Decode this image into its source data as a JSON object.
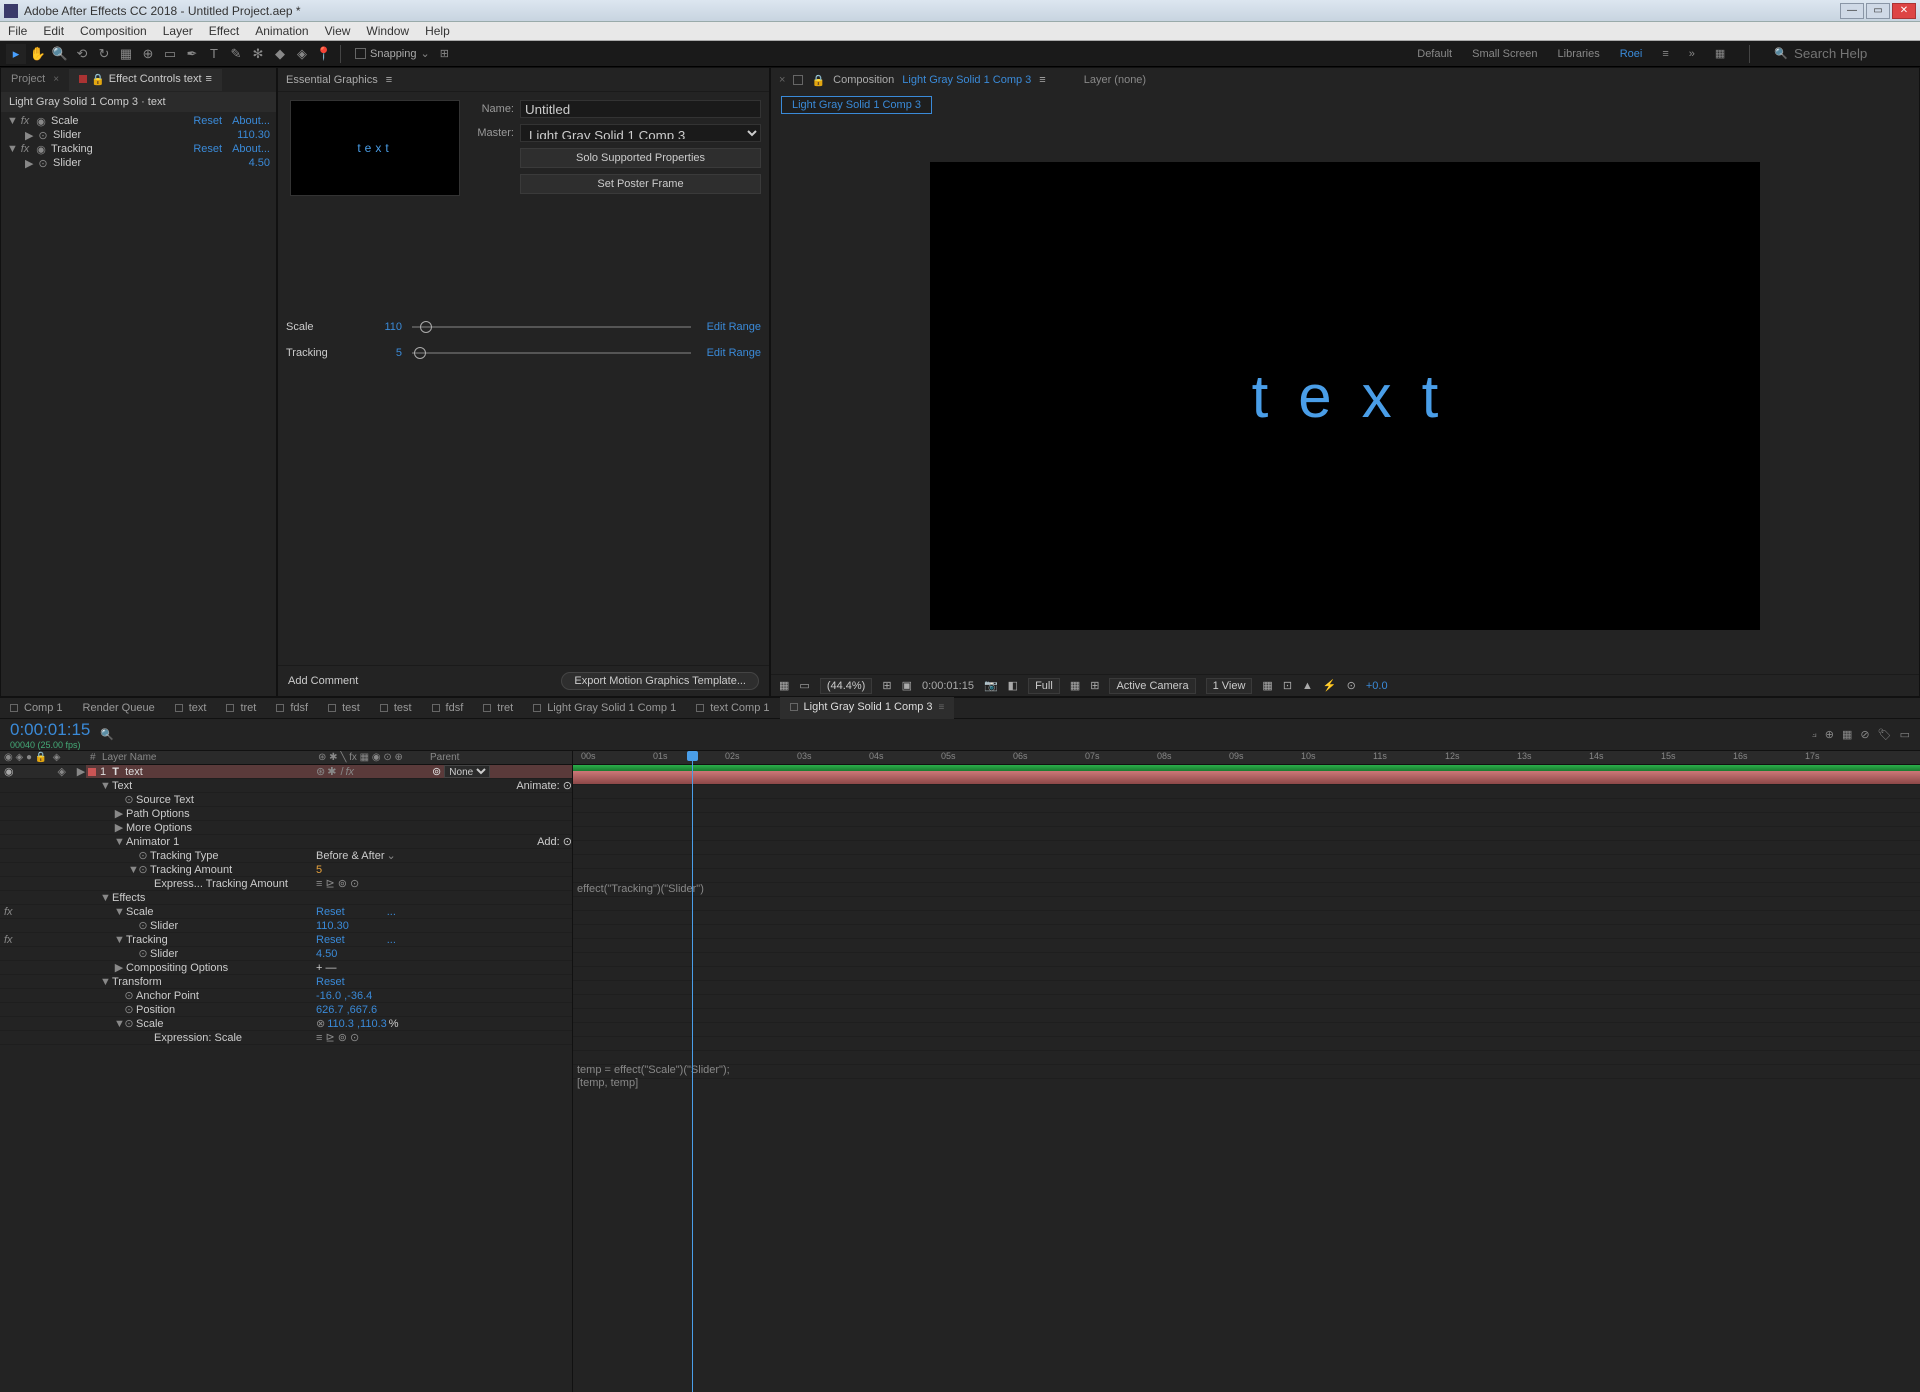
{
  "title": "Adobe After Effects CC 2018 - Untitled Project.aep *",
  "menu": [
    "File",
    "Edit",
    "Composition",
    "Layer",
    "Effect",
    "Animation",
    "View",
    "Window",
    "Help"
  ],
  "toolbar": {
    "snapping": "Snapping",
    "workspaces": [
      "Default",
      "Small Screen",
      "Libraries"
    ],
    "active_workspace": "Roei",
    "search_placeholder": "Search Help"
  },
  "project_panel": {
    "tabs": [
      {
        "label": "Project"
      },
      {
        "label": "Effect Controls text",
        "active": true
      }
    ],
    "header": "Light Gray Solid 1 Comp 3 · text",
    "effects": [
      {
        "name": "Scale",
        "reset": "Reset",
        "about": "About...",
        "slider_label": "Slider",
        "slider_value": "110.30"
      },
      {
        "name": "Tracking",
        "reset": "Reset",
        "about": "About...",
        "slider_label": "Slider",
        "slider_value": "4.50"
      }
    ]
  },
  "eg_panel": {
    "title": "Essential Graphics",
    "preview_text": "text",
    "name_label": "Name:",
    "name_value": "Untitled",
    "master_label": "Master:",
    "master_value": "Light Gray Solid 1 Comp 3",
    "solo_btn": "Solo Supported Properties",
    "poster_btn": "Set Poster Frame",
    "sliders": [
      {
        "label": "Scale",
        "value": "110",
        "pos": 8,
        "edit": "Edit Range"
      },
      {
        "label": "Tracking",
        "value": "5",
        "pos": 2,
        "edit": "Edit Range"
      }
    ],
    "add_comment": "Add Comment",
    "export": "Export Motion Graphics Template..."
  },
  "comp_panel": {
    "prefix": "Composition",
    "name": "Light Gray Solid 1 Comp 3",
    "layer_label": "Layer  (none)",
    "breadcrumb": "Light Gray Solid 1 Comp 3",
    "canvas_text": "text",
    "controls": {
      "zoom": "(44.4%)",
      "time": "0:00:01:15",
      "res": "Full",
      "camera": "Active Camera",
      "views": "1 View",
      "exposure": "+0.0"
    }
  },
  "timeline": {
    "tabs": [
      {
        "label": "Comp 1"
      },
      {
        "label": "Render Queue",
        "nosq": true
      },
      {
        "label": "text"
      },
      {
        "label": "tret"
      },
      {
        "label": "fdsf"
      },
      {
        "label": "test"
      },
      {
        "label": "test"
      },
      {
        "label": "fdsf"
      },
      {
        "label": "tret"
      },
      {
        "label": "Light Gray Solid 1 Comp 1"
      },
      {
        "label": "text Comp 1"
      },
      {
        "label": "Light Gray Solid 1 Comp 3",
        "active": true,
        "close": true
      }
    ],
    "current_time": "0:00:01:15",
    "sub_time": "00040 (25.00 fps)",
    "col_headers": {
      "num": "#",
      "layer": "Layer Name",
      "parent": "Parent"
    },
    "ticks": [
      "00s",
      "01s",
      "02s",
      "03s",
      "04s",
      "05s",
      "06s",
      "07s",
      "08s",
      "09s",
      "10s",
      "11s",
      "12s",
      "13s",
      "14s",
      "15s",
      "16s",
      "17s"
    ],
    "layer": {
      "num": "1",
      "icon": "T",
      "name": "text",
      "mode": "None",
      "rows": [
        {
          "indent": 1,
          "tw": "▼",
          "name": "Text",
          "right": "Animate: ⊙"
        },
        {
          "indent": 2,
          "stop": "⊙",
          "name": "Source Text"
        },
        {
          "indent": 2,
          "tw": "▶",
          "name": "Path Options"
        },
        {
          "indent": 2,
          "tw": "▶",
          "name": "More Options"
        },
        {
          "indent": 2,
          "tw": "▼",
          "name": "Animator 1",
          "right": "Add: ⊙"
        },
        {
          "indent": 3,
          "stop": "⊙",
          "name": "Tracking Type",
          "val": "Before & After",
          "dd": true
        },
        {
          "indent": 3,
          "tw": "▼",
          "stop": "⊙",
          "name": "Tracking Amount",
          "val": "5",
          "orange": true
        },
        {
          "indent": 4,
          "name": "Express... Tracking Amount",
          "expr": true
        },
        {
          "indent": 1,
          "tw": "▼",
          "name": "Effects"
        },
        {
          "indent": 2,
          "tw": "▼",
          "name": "Scale",
          "link": "Reset",
          "dots": true,
          "fx": true
        },
        {
          "indent": 3,
          "stop": "⊙",
          "name": "Slider",
          "link": "110.30"
        },
        {
          "indent": 2,
          "tw": "▼",
          "name": "Tracking",
          "link": "Reset",
          "dots": true,
          "fx": true
        },
        {
          "indent": 3,
          "stop": "⊙",
          "name": "Slider",
          "link": "4.50"
        },
        {
          "indent": 2,
          "tw": "▶",
          "name": "Compositing Options",
          "plus": true
        },
        {
          "indent": 1,
          "tw": "▼",
          "name": "Transform",
          "link": "Reset"
        },
        {
          "indent": 2,
          "stop": "⊙",
          "name": "Anchor Point",
          "link": "-16.0 ,-36.4"
        },
        {
          "indent": 2,
          "stop": "⊙",
          "name": "Position",
          "link": "626.7 ,667.6"
        },
        {
          "indent": 2,
          "tw": "▼",
          "stop": "⊙",
          "name": "Scale",
          "linkpair": "110.3 ,110.3",
          "pct": "%",
          "chain": true
        },
        {
          "indent": 4,
          "name": "Expression: Scale",
          "expr": true
        }
      ]
    },
    "expr1": "effect(\"Tracking\")(\"Slider\")",
    "expr2a": "temp = effect(\"Scale\")(\"Slider\");",
    "expr2b": "[temp, temp]"
  }
}
